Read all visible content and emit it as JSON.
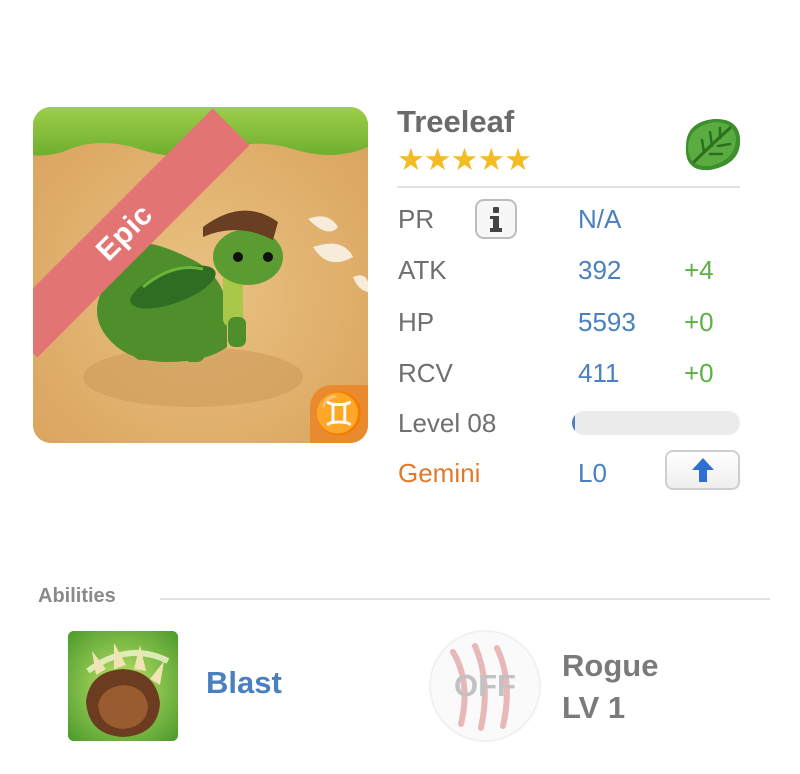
{
  "monster": {
    "rarity": "Epic",
    "name": "Treeleaf",
    "stars": "★★★★★",
    "star_count": 5,
    "element_icon": "leaf-icon",
    "sign_icon": "gemini-icon",
    "sign_glyph": "♊"
  },
  "stats": {
    "pr": {
      "label": "PR",
      "value": "N/A"
    },
    "atk": {
      "label": "ATK",
      "value": "392",
      "bonus": "+4"
    },
    "hp": {
      "label": "HP",
      "value": "5593",
      "bonus": "+0"
    },
    "rcv": {
      "label": "RCV",
      "value": "411",
      "bonus": "+0"
    },
    "level": {
      "label": "Level 08",
      "progress": 0.02
    },
    "sign": {
      "label": "Gemini",
      "value": "L0"
    }
  },
  "abilities": {
    "title": "Abilities",
    "skill": {
      "name": "Blast",
      "icon": "claw-icon"
    },
    "class": {
      "status": "OFF",
      "name": "Rogue",
      "level": "LV 1",
      "icon": "scratch-icon"
    }
  },
  "colors": {
    "accent_blue": "#4a7fc0",
    "bonus_green": "#5db046",
    "star_gold": "#f3bd21",
    "epic_ribbon": "#e27474",
    "gemini_orange": "#e07a2a"
  }
}
